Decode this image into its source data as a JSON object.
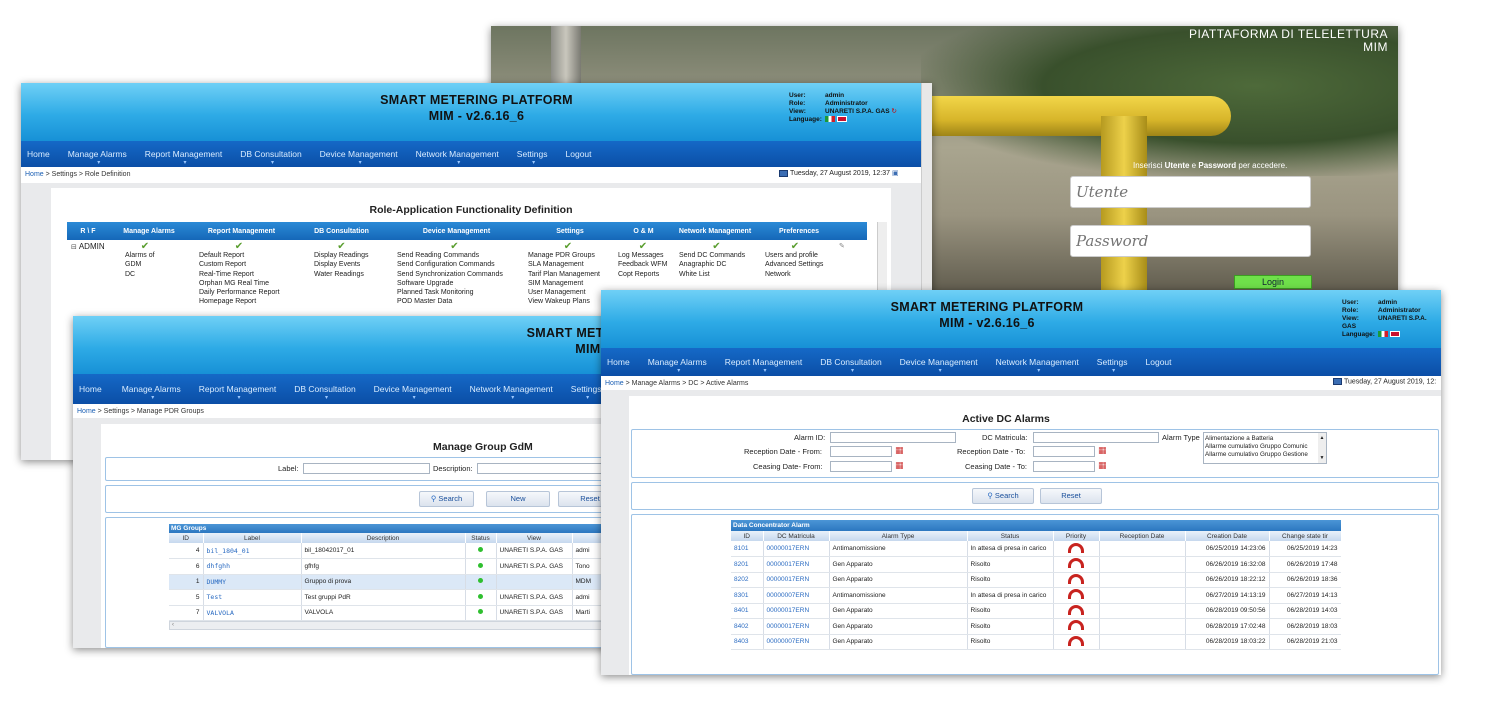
{
  "common": {
    "app_title": "SMART METERING PLATFORM",
    "version": "MIM - v2.6.16_6",
    "user": {
      "user_label": "User:",
      "user_value": "admin",
      "role_label": "Role:",
      "role_value": "Administrator",
      "view_label": "View:",
      "view_value": "UNARETI S.P.A. GAS",
      "language_label": "Language:"
    },
    "nav": [
      "Home",
      "Manage Alarms",
      "Report Management",
      "DB Consultation",
      "Device Management",
      "Network Management",
      "Settings",
      "Logout"
    ],
    "home_link": "Home",
    "date": "Tuesday, 27 August 2019, 12:37",
    "date_trunc": "Tuesday, 27 August 2019, 12:"
  },
  "login": {
    "brand_line1": "PIATTAFORMA DI TELELETTURA",
    "brand_line2": "MIM",
    "instruction_pre": "Inserisci ",
    "instruction_user": "Utente",
    "instruction_mid": " e ",
    "instruction_pwd": "Password",
    "instruction_post": " per accedere.",
    "username_placeholder": "Utente",
    "password_placeholder": "Password",
    "login_button": "Login"
  },
  "role_window": {
    "breadcrumb": " > Settings > Role Definition",
    "title": "Role-Application Functionality Definition",
    "columns": [
      "R \\ F",
      "Manage Alarms",
      "Report Management",
      "DB Consultation",
      "Device Management",
      "Settings",
      "O & M",
      "Network Management",
      "Preferences"
    ],
    "role_name": "ADMIN",
    "lists": {
      "alarms": [
        "Alarms of",
        "GDM",
        "DC"
      ],
      "report": [
        "Default Report",
        "Custom Report",
        "Real-Time Report",
        "Orphan MG Real Time",
        "Daily Performance Report",
        "Homepage Report"
      ],
      "db": [
        "Display Readings",
        "Display Events",
        "Water Readings"
      ],
      "device": [
        "Send Reading Commands",
        "Send Configuration Commands",
        "Send Synchronization Commands",
        "Software Upgrade",
        "Planned Task Monitoring",
        "POD Master Data"
      ],
      "settings": [
        "Manage PDR Groups",
        "SLA Management",
        "Tarif Plan Management",
        "SIM Management",
        "User Management",
        "View Wakeup Plans"
      ],
      "om": [
        "Log Messages",
        "Feedback WFM",
        "Copt Reports"
      ],
      "network": [
        "Send DC Commands",
        "Anagraphic DC",
        "White List"
      ],
      "prefs": [
        "Users and profile",
        "Advanced Settings",
        "Network"
      ]
    }
  },
  "groups_window": {
    "breadcrumb": " > Settings > Manage PDR Groups",
    "title": "Manage Group GdM",
    "label_label": "Label:",
    "description_label": "Description:",
    "search": "Search",
    "new": "New",
    "reset": "Reset",
    "table_caption": "MG Groups",
    "columns": [
      "ID",
      "Label",
      "Description",
      "Status",
      "View",
      "C"
    ],
    "rows": [
      {
        "id": "4",
        "label": "bil_1804_01",
        "description": "bil_18042017_01",
        "view": "UNARETI S.P.A. GAS",
        "c": "admi"
      },
      {
        "id": "6",
        "label": "dhfghh",
        "description": "gfhfg",
        "view": "UNARETI S.P.A. GAS",
        "c": "Tono"
      },
      {
        "id": "1",
        "label": "DUMMY",
        "description": "Gruppo di prova",
        "view": "",
        "c": "MDM"
      },
      {
        "id": "5",
        "label": "Test",
        "description": "Test gruppi PdR",
        "view": "UNARETI S.P.A. GAS",
        "c": "admi"
      },
      {
        "id": "7",
        "label": "VALVOLA",
        "description": "VALVOLA",
        "view": "UNARETI S.P.A. GAS",
        "c": "Marti"
      }
    ]
  },
  "alarms_window": {
    "breadcrumb": " > Manage Alarms > DC > Active Alarms",
    "title": "Active DC Alarms",
    "alarm_id_label": "Alarm ID:",
    "dc_matricula_label": "DC Matricula:",
    "alarm_type_label": "Alarm Type",
    "alarm_type_options": [
      "Alimentazione a Batteria",
      "Allarme cumulativo Gruppo Comunic",
      "Allarme cumulativo Gruppo Gestione"
    ],
    "reception_from_label": "Reception Date - From:",
    "reception_to_label": "Reception Date - To:",
    "ceasing_from_label": "Ceasing Date- From:",
    "ceasing_to_label": "Ceasing Date - To:",
    "search": "Search",
    "reset": "Reset",
    "table_caption": "Data Concentrator Alarm",
    "columns": [
      "ID",
      "DC Matricula",
      "Alarm Type",
      "Status",
      "Priority",
      "Reception Date",
      "Creation Date",
      "Change state tir"
    ],
    "rows": [
      {
        "id": "8101",
        "dc": "00000017ERN",
        "type": "Antimanomissione",
        "status": "In attesa di presa in carico",
        "reception": "",
        "creation": "06/25/2019 14:23:06",
        "change": "06/25/2019 14:23"
      },
      {
        "id": "8201",
        "dc": "00000017ERN",
        "type": "Gen Apparato",
        "status": "Risolto",
        "reception": "",
        "creation": "06/26/2019 16:32:08",
        "change": "06/26/2019 17:48"
      },
      {
        "id": "8202",
        "dc": "00000017ERN",
        "type": "Gen Apparato",
        "status": "Risolto",
        "reception": "",
        "creation": "06/26/2019 18:22:12",
        "change": "06/26/2019 18:36"
      },
      {
        "id": "8301",
        "dc": "00000007ERN",
        "type": "Antimanomissione",
        "status": "In attesa di presa in carico",
        "reception": "",
        "creation": "06/27/2019 14:13:19",
        "change": "06/27/2019 14:13"
      },
      {
        "id": "8401",
        "dc": "00000017ERN",
        "type": "Gen Apparato",
        "status": "Risolto",
        "reception": "",
        "creation": "06/28/2019 09:50:56",
        "change": "06/28/2019 14:03"
      },
      {
        "id": "8402",
        "dc": "00000017ERN",
        "type": "Gen Apparato",
        "status": "Risolto",
        "reception": "",
        "creation": "06/28/2019 17:02:48",
        "change": "06/28/2019 18:03"
      },
      {
        "id": "8403",
        "dc": "00000007ERN",
        "type": "Gen Apparato",
        "status": "Risolto",
        "reception": "",
        "creation": "06/28/2019 18:03:22",
        "change": "06/28/2019 21:03"
      }
    ]
  },
  "colors": {
    "header": "#2eabe6",
    "nav": "#0b4ea6",
    "link": "#2a6bc2",
    "status_ok": "#2fbf2f",
    "priority": "#c8231f",
    "login_button": "#6fe04a"
  }
}
